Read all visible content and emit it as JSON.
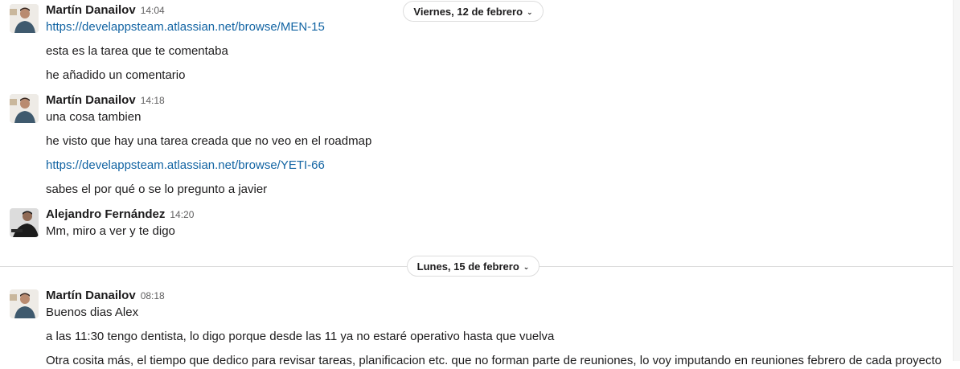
{
  "date_dividers": [
    {
      "label": "Viernes, 12 de febrero"
    },
    {
      "label": "Lunes, 15 de febrero"
    }
  ],
  "messages": [
    {
      "author": "Martín Danailov",
      "time": "14:04",
      "avatar": "martin-avatar",
      "lines": [
        "https://develappsteam.atlassian.net/browse/MEN-15",
        "esta es la tarea que te comentaba",
        "he añadido un comentario"
      ]
    },
    {
      "author": "Martín Danailov",
      "time": "14:18",
      "avatar": "martin-avatar",
      "lines": [
        "una cosa tambien",
        "he visto que hay una tarea creada que no veo en el roadmap",
        "https://develappsteam.atlassian.net/browse/YETI-66",
        "sabes el por qué o se lo pregunto a javier"
      ]
    },
    {
      "author": "Alejandro Fernández",
      "time": "14:20",
      "avatar": "alejandro-avatar",
      "lines": [
        "Mm, miro a ver y te digo"
      ]
    },
    {
      "author": "Martín Danailov",
      "time": "08:18",
      "avatar": "martin-avatar",
      "lines": [
        "Buenos dias Alex",
        "a las 11:30 tengo dentista, lo digo porque desde las 11 ya no estaré operativo hasta que vuelva",
        "Otra cosita más, el tiempo que dedico para revisar tareas, planificacion etc. que no forman parte de reuniones, lo voy imputando en reuniones febrero de cada proyecto"
      ]
    }
  ],
  "colors": {
    "link": "#1264a3",
    "text": "#1d1c1d",
    "muted": "#616061"
  }
}
